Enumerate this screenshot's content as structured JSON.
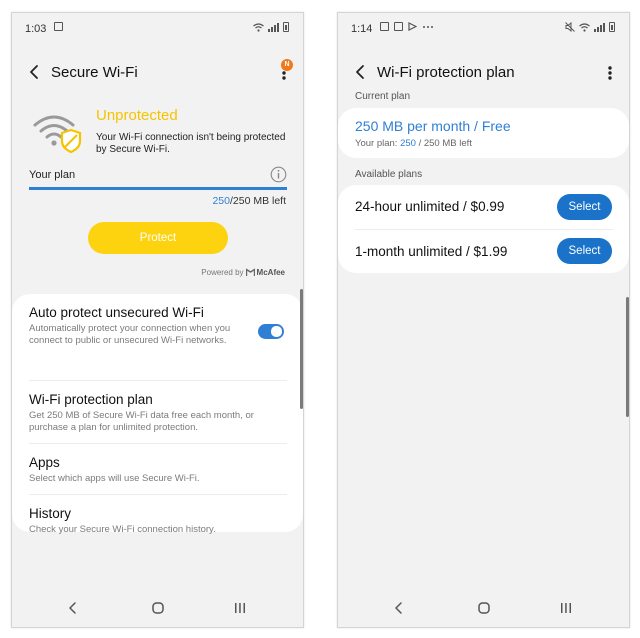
{
  "left_screen": {
    "status_bar": {
      "time": "1:03"
    },
    "app_bar": {
      "title": "Secure Wi-Fi",
      "badge": "N"
    },
    "protection": {
      "status": "Unprotected",
      "description": "Your Wi-Fi connection isn't being protected by Secure Wi-Fi."
    },
    "plan": {
      "label": "Your plan",
      "used": "250",
      "remaining_text": "/250 MB left",
      "fill_fraction": 1.0
    },
    "protect_button": "Protect",
    "powered_by": {
      "prefix": "Powered by",
      "brand": "McAfee"
    },
    "settings": [
      {
        "title": "Auto protect unsecured Wi-Fi",
        "desc": "Automatically protect your connection when you connect to public or unsecured Wi-Fi networks.",
        "toggle_on": true
      },
      {
        "title": "Wi-Fi protection plan",
        "desc": "Get 250 MB of Secure Wi-Fi data free each month, or purchase a plan for unlimited protection."
      },
      {
        "title": "Apps",
        "desc": "Select which apps will use Secure Wi-Fi."
      },
      {
        "title": "History",
        "desc": "Check your Secure Wi-Fi connection history."
      }
    ]
  },
  "right_screen": {
    "status_bar": {
      "time": "1:14"
    },
    "app_bar": {
      "title": "Wi-Fi protection plan"
    },
    "current_plan": {
      "section_label": "Current plan",
      "title": "250 MB per month / Free",
      "sub_prefix": "Your plan: ",
      "used": "250",
      "sub_suffix": " / 250 MB left"
    },
    "available_plans": {
      "section_label": "Available plans",
      "items": [
        {
          "label": "24-hour unlimited / $0.99",
          "button": "Select"
        },
        {
          "label": "1-month unlimited / $1.99",
          "button": "Select"
        }
      ]
    }
  },
  "colors": {
    "accent_blue": "#2f7fd4",
    "warning_yellow": "#f5c400",
    "protect_button": "#fdd20f",
    "badge_orange": "#f07a1a",
    "select_button": "#1a73c9"
  },
  "icons": {
    "wifi_shield": "wifi-warning-shield-icon",
    "info": "info-icon",
    "toggle": "toggle-switch"
  }
}
